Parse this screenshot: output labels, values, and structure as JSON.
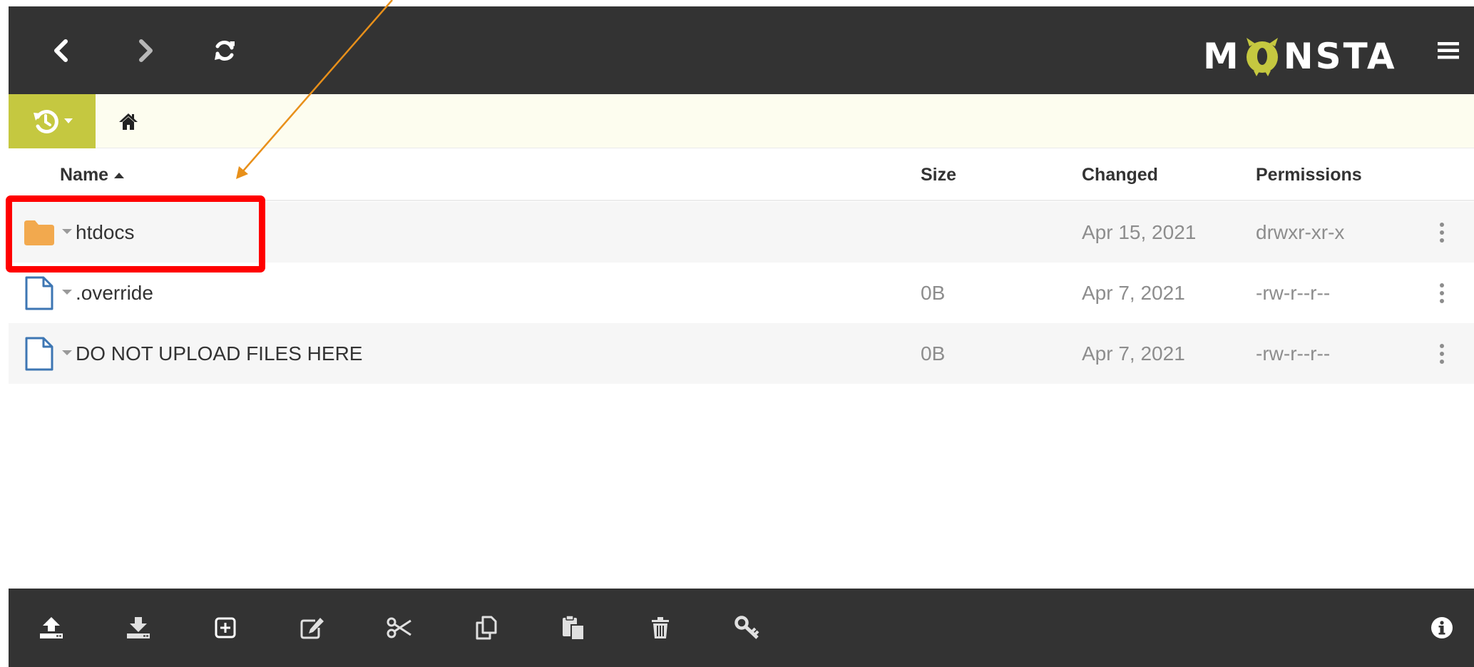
{
  "app": {
    "logo_text_left": "M",
    "logo_text_right": "NSTA"
  },
  "colors": {
    "topbar": "#333333",
    "accent_green": "#c5c840",
    "crumb_bg": "#fdfdef",
    "folder": "#f2a94e",
    "file_outline": "#3d76b3",
    "highlight": "#ff0000",
    "annotation_arrow": "#e8901a"
  },
  "toolbar_top": {
    "back": "chevron-left-icon",
    "forward": "chevron-right-icon",
    "refresh": "refresh-icon",
    "menu": "hamburger-menu-icon"
  },
  "breadcrumb": {
    "history": "history-icon",
    "home": "home-icon"
  },
  "table": {
    "columns": {
      "name": "Name",
      "size": "Size",
      "changed": "Changed",
      "permissions": "Permissions"
    },
    "sort": {
      "column": "name",
      "direction": "ascending"
    },
    "rows": [
      {
        "name": "htdocs",
        "type": "folder",
        "size": "",
        "changed": "Apr 15, 2021",
        "permissions": "drwxr-xr-x"
      },
      {
        "name": ".override",
        "type": "file",
        "size": "0B",
        "changed": "Apr 7, 2021",
        "permissions": "-rw-r--r--"
      },
      {
        "name": "DO NOT UPLOAD FILES HERE",
        "type": "file",
        "size": "0B",
        "changed": "Apr 7, 2021",
        "permissions": "-rw-r--r--"
      }
    ]
  },
  "annotation": {
    "highlighted_item": "htdocs"
  },
  "toolbar_bottom": [
    "upload-icon",
    "download-icon",
    "new-item-icon",
    "edit-icon",
    "cut-icon",
    "copy-icon",
    "paste-icon",
    "delete-icon",
    "permissions-key-icon",
    "info-icon"
  ]
}
